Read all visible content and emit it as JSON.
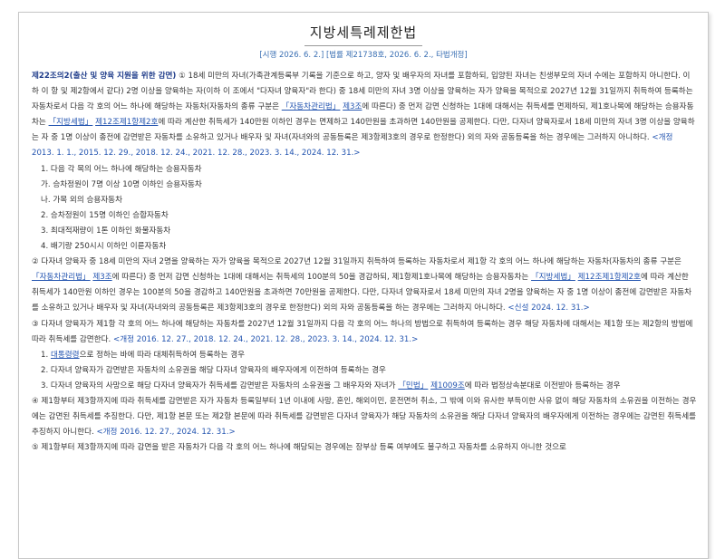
{
  "title": "지방세특례제한법",
  "meta": "[시행 2026. 6. 2.] [법률 제21738호, 2026. 6. 2., 타법개정]",
  "para1": {
    "article": "제22조의2(출산 및 양육 지원을 위한 감면)",
    "t1": " ① 18세 미만의 자녀(가족관계등록부 기록을 기준으로 하고, 양자 및 배우자의 자녀를 포함하되, 입양된 자녀는 친생부모의 자녀 수에는 포함하지 아니한다. 이하 이 항 및 제2항에서 같다) 2명 이상을 양육하는 자(이하 이 조에서 \"다자녀 양육자\"라 한다) 중 18세 미만의 자녀 3명 이상을 양육하는 자가 양육을 목적으로 2027년 12월 31일까지 취득하여 등록하는 자동차로서 다음 각 호의 어느 하나에 해당하는 자동차(자동차의 종류 구분은 ",
    "law1": "「자동차관리법」",
    "t2": " ",
    "link1": "제3조",
    "t3": "에 따른다) 중 먼저 감면 신청하는 1대에 대해서는 취득세를 면제하되, 제1호나목에 해당하는 승용자동차는 ",
    "law2": "「지방세법」",
    "t4": " ",
    "link2": "제12조제1항제2호",
    "t5": "에 따라 계산한 취득세가 140만원 이하인 경우는 면제하고 140만원을 초과하면 140만원을 공제한다. 다만, 다자녀 양육자로서 18세 미만의 자녀 3명 이상을 양육하는 자 중 1명 이상이 종전에 감면받은 자동차를 소유하고 있거나 배우자 및 자녀(자녀와의 공동등록은 제3항제3호의 경우로 한정한다) 외의 자와 공동등록을 하는 경우에는 그러하지 아니하다.",
    "rev": " <개정 2013. 1. 1., 2015. 12. 29., 2018. 12. 24., 2021. 12. 28., 2023. 3. 14., 2024. 12. 31.>"
  },
  "items1": [
    {
      "text": "1. 다음 각 목의 어느 하나에 해당하는 승용자동차",
      "level": 1
    },
    {
      "text": "가. 승차정원이 7명 이상 10명 이하인 승용자동차",
      "level": 2
    },
    {
      "text": "나. 가목 외의 승용자동차",
      "level": 2
    },
    {
      "text": "2. 승차정원이 15명 이하인 승합자동차",
      "level": 1
    },
    {
      "text": "3. 최대적재량이 1톤 이하인 화물자동차",
      "level": 1
    },
    {
      "text": "4. 배기량 250시시 이하인 이륜자동차",
      "level": 1
    }
  ],
  "para2": {
    "t1": "② 다자녀 양육자 중 18세 미만의 자녀 2명을 양육하는 자가 양육을 목적으로 2027년 12월 31일까지 취득하여 등록하는 자동차로서 제1항 각 호의 어느 하나에 해당하는 자동차(자동차의 종류 구분은 ",
    "law1": "「자동차관리법」",
    "t2": " ",
    "link1": "제3조",
    "t3": "에 따른다) 중 먼저 감면 신청하는 1대에 대해서는 취득세의 100분의 50을 경감하되, 제1항제1호나목에 해당하는 승용자동차는 ",
    "law2": "「지방세법」",
    "t4": " ",
    "link2": "제12조제1항제2호",
    "t5": "에 따라 계산한 취득세가 140만원 이하인 경우는 100분의 50을 경감하고 140만원을 초과하면 70만원을 공제한다. 다만, 다자녀 양육자로서 18세 미만의 자녀 2명을 양육하는 자 중 1명 이상이 종전에 감면받은 자동차를 소유하고 있거나 배우자 및 자녀(자녀와의 공동등록은 제3항제3호의 경우로 한정한다) 외의 자와 공동등록을 하는 경우에는 그러하지 아니하다.",
    "rev": " <신설 2024. 12. 31.>"
  },
  "para3": {
    "t1": "③ 다자녀 양육자가 제1항 각 호의 어느 하나에 해당하는 자동차를 2027년 12월 31일까지 다음 각 호의 어느 하나의 방법으로 취득하여 등록하는 경우 해당 자동차에 대해서는 제1항 또는 제2항의 방법에 따라 취득세를 감면한다.",
    "rev": " <개정 2016. 12. 27., 2018. 12. 24., 2021. 12. 28., 2023. 3. 14., 2024. 12. 31.>"
  },
  "items3": {
    "i1_pre": "1. ",
    "i1_link": "대통령령",
    "i1_post": "으로 정하는 바에 따라 대체취득하여 등록하는 경우",
    "i2": "2. 다자녀 양육자가 감면받은 자동차의 소유권을 해당 다자녀 양육자의 배우자에게 이전하여 등록하는 경우",
    "i3_pre": "3. 다자녀 양육자의 사망으로 해당 다자녀 양육자가 취득세를 감면받은 자동차의 소유권을 그 배우자와 자녀가 ",
    "i3_law": "「민법」",
    "i3_mid": " ",
    "i3_link": "제1009조",
    "i3_post": "에 따라 법정상속분대로 이전받아 등록하는 경우"
  },
  "para4": {
    "t1": "④ 제1항부터 제3항까지에 따라 취득세를 감면받은 자가 자동차 등록일부터 1년 이내에 사망, 혼인, 해외이민, 운전면허 취소, 그 밖에 이와 유사한 부득이한 사유 없이 해당 자동차의 소유권을 이전하는 경우에는 감면된 취득세를 추징한다. 다만, 제1항 본문 또는 제2항 본문에 따라 취득세를 감면받은 다자녀 양육자가 해당 자동차의 소유권을 해당 다자녀 양육자의 배우자에게 이전하는 경우에는 감면된 취득세를 추징하지 아니한다.",
    "rev": " <개정 2016. 12. 27., 2024. 12. 31.>"
  },
  "para5": {
    "t1": "⑤ 제1항부터 제3항까지에 따라 감면을 받은 자동차가 다음 각 호의 어느 하나에 해당되는 경우에는 장부상 등록 여부에도 불구하고 자동차를 소유하지 아니한 것으로"
  }
}
